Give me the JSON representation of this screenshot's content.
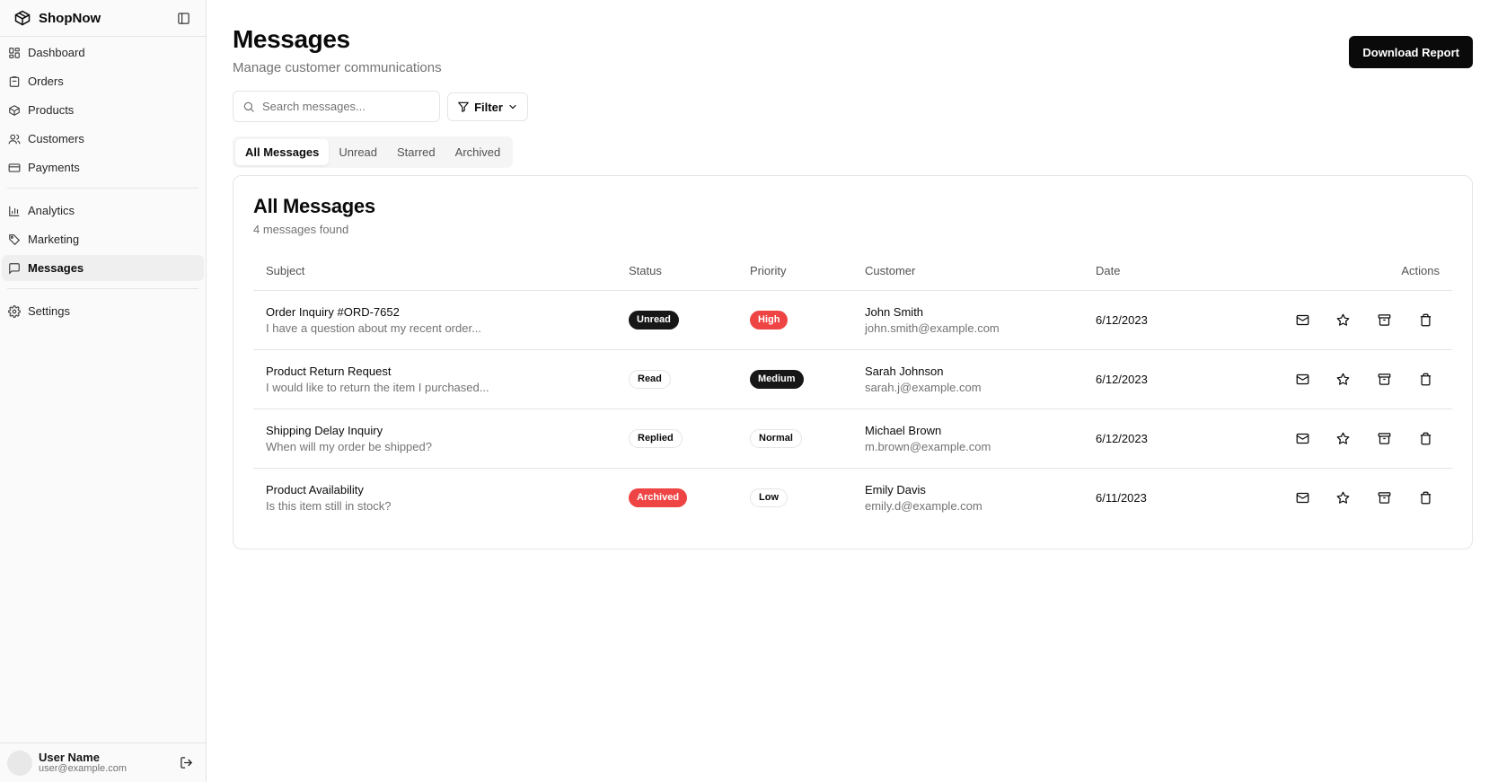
{
  "app": {
    "brand": "ShopNow",
    "logo_icon": "package-icon",
    "toggle_icon": "sidebar-toggle-icon"
  },
  "sidebar": {
    "items_group1": [
      {
        "label": "Dashboard",
        "icon": "dashboard-icon"
      },
      {
        "label": "Orders",
        "icon": "clipboard-icon"
      },
      {
        "label": "Products",
        "icon": "package-icon"
      },
      {
        "label": "Customers",
        "icon": "users-icon"
      },
      {
        "label": "Payments",
        "icon": "credit-card-icon"
      }
    ],
    "items_group2": [
      {
        "label": "Analytics",
        "icon": "bar-chart-icon"
      },
      {
        "label": "Marketing",
        "icon": "tag-icon"
      },
      {
        "label": "Messages",
        "icon": "message-icon",
        "active": true
      }
    ],
    "items_group3": [
      {
        "label": "Settings",
        "icon": "gear-icon"
      }
    ],
    "user": {
      "name": "User Name",
      "email": "user@example.com",
      "logout_icon": "logout-icon"
    }
  },
  "header": {
    "title": "Messages",
    "subtitle": "Manage customer communications",
    "download_label": "Download Report"
  },
  "toolbar": {
    "search_placeholder": "Search messages...",
    "filter_label": "Filter"
  },
  "tabs": [
    {
      "label": "All Messages",
      "active": true
    },
    {
      "label": "Unread"
    },
    {
      "label": "Starred"
    },
    {
      "label": "Archived"
    }
  ],
  "card": {
    "title": "All Messages",
    "subtitle": "4 messages found"
  },
  "table": {
    "columns": {
      "subject": "Subject",
      "status": "Status",
      "priority": "Priority",
      "customer": "Customer",
      "date": "Date",
      "actions": "Actions"
    },
    "rows": [
      {
        "subject": "Order Inquiry #ORD-7652",
        "preview": "I have a question about my recent order...",
        "status": "Unread",
        "status_style": "dark",
        "priority": "High",
        "priority_style": "red",
        "customer_name": "John Smith",
        "customer_email": "john.smith@example.com",
        "date": "6/12/2023"
      },
      {
        "subject": "Product Return Request",
        "preview": "I would like to return the item I purchased...",
        "status": "Read",
        "status_style": "outline",
        "priority": "Medium",
        "priority_style": "dark",
        "customer_name": "Sarah Johnson",
        "customer_email": "sarah.j@example.com",
        "date": "6/12/2023"
      },
      {
        "subject": "Shipping Delay Inquiry",
        "preview": "When will my order be shipped?",
        "status": "Replied",
        "status_style": "outline",
        "priority": "Normal",
        "priority_style": "outline",
        "customer_name": "Michael Brown",
        "customer_email": "m.brown@example.com",
        "date": "6/12/2023"
      },
      {
        "subject": "Product Availability",
        "preview": "Is this item still in stock?",
        "status": "Archived",
        "status_style": "red",
        "priority": "Low",
        "priority_style": "outline",
        "customer_name": "Emily Davis",
        "customer_email": "emily.d@example.com",
        "date": "6/11/2023"
      }
    ],
    "row_action_icons": [
      "mail-icon",
      "star-icon",
      "archive-icon",
      "trash-icon"
    ]
  },
  "colors": {
    "accent": "#0a0a0a",
    "danger": "#ef4444",
    "muted": "#737373",
    "border": "#e5e5e5"
  }
}
